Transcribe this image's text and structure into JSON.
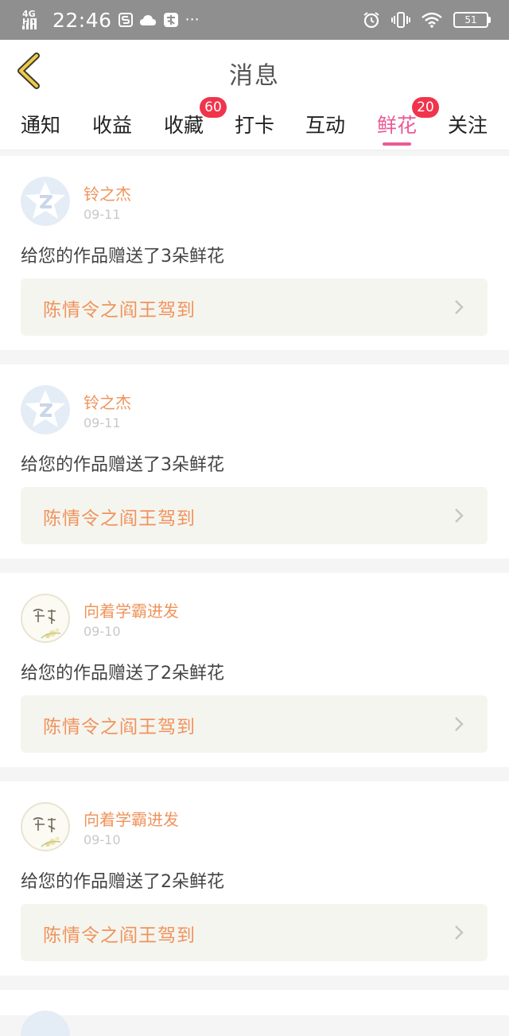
{
  "status_bar": {
    "network": "4G HD",
    "time": "22:46",
    "battery": "51",
    "left_icons": [
      "notification-s-icon",
      "cloud-icon",
      "app-notification-icon",
      "more-dots-icon"
    ],
    "more": "···",
    "right_icons": [
      "alarm-icon",
      "vibrate-icon",
      "wifi-icon",
      "battery-icon"
    ]
  },
  "header": {
    "title": "消息"
  },
  "tabs": [
    {
      "label": "通知"
    },
    {
      "label": "收益"
    },
    {
      "label": "收藏",
      "badge": "60"
    },
    {
      "label": "打卡"
    },
    {
      "label": "互动"
    },
    {
      "label": "鲜花",
      "badge": "20",
      "active": true
    },
    {
      "label": "关注"
    }
  ],
  "colors": {
    "accent_pink": "#ea5a98",
    "name_orange": "#f0935c",
    "badge_red": "#f0344c",
    "status_bar": "#8f8f8f"
  },
  "messages": [
    {
      "user": "铃之杰",
      "date": "09-11",
      "text": "给您的作品赠送了3朵鲜花",
      "work": "陈情令之阎王驾到",
      "avatar": "star-badge-avatar"
    },
    {
      "user": "铃之杰",
      "date": "09-11",
      "text": "给您的作品赠送了3朵鲜花",
      "work": "陈情令之阎王驾到",
      "avatar": "star-badge-avatar"
    },
    {
      "user": "向着学霸进发",
      "date": "09-10",
      "text": "给您的作品赠送了2朵鲜花",
      "work": "陈情令之阎王驾到",
      "avatar": "floral-calligraphy-avatar"
    },
    {
      "user": "向着学霸进发",
      "date": "09-10",
      "text": "给您的作品赠送了2朵鲜花",
      "work": "陈情令之阎王驾到",
      "avatar": "floral-calligraphy-avatar"
    }
  ]
}
